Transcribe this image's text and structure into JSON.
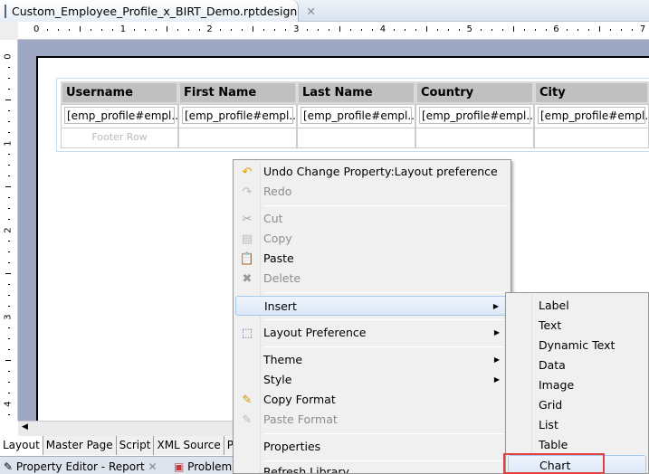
{
  "editor_tab": {
    "title": "Custom_Employee_Profile_x_BIRT_Demo.rptdesign",
    "icon": "report-design-icon"
  },
  "ruler": {
    "h_labels": [
      "0",
      "1",
      "2",
      "3",
      "4",
      "5",
      "6",
      "7"
    ],
    "v_labels": [
      "0",
      "1",
      "2",
      "3",
      "4"
    ]
  },
  "table": {
    "headers": [
      "Username",
      "First Name",
      "Last Name",
      "Country",
      "City"
    ],
    "row": [
      "[emp_profile#empl...]",
      "[emp_profile#empl...]",
      "[emp_profile#empl...]",
      "[emp_profile#empl...]",
      "[emp_profile#empl...]"
    ],
    "footer_label": "Footer Row"
  },
  "bottom_tabs": [
    "Layout",
    "Master Page",
    "Script",
    "XML Source",
    "Prev"
  ],
  "panel_tabs": [
    "Property Editor - Report",
    "Problem"
  ],
  "context_menu": {
    "items": [
      {
        "label": "Undo Change Property:Layout preference",
        "icon": "undo-icon",
        "disabled": false
      },
      {
        "label": "Redo",
        "icon": "redo-icon",
        "disabled": true
      },
      {
        "label": "Cut",
        "icon": "scissors-icon",
        "disabled": true
      },
      {
        "label": "Copy",
        "icon": "copy-icon",
        "disabled": true
      },
      {
        "label": "Paste",
        "icon": "paste-icon",
        "disabled": false
      },
      {
        "label": "Delete",
        "icon": "delete-icon",
        "disabled": true
      },
      {
        "label": "Insert",
        "submenu": true,
        "highlighted": true
      },
      {
        "label": "Layout Preference",
        "icon": "layout-icon",
        "submenu": true
      },
      {
        "label": "Theme",
        "submenu": true
      },
      {
        "label": "Style",
        "submenu": true
      },
      {
        "label": "Copy Format",
        "icon": "copy-format-icon",
        "disabled": false
      },
      {
        "label": "Paste Format",
        "icon": "paste-format-icon",
        "disabled": true
      },
      {
        "label": "Properties"
      },
      {
        "label": "Refresh Library"
      }
    ]
  },
  "insert_submenu": {
    "items": [
      "Label",
      "Text",
      "Dynamic Text",
      "Data",
      "Image",
      "Grid",
      "List",
      "Table",
      "Chart"
    ],
    "highlighted": "Chart",
    "highlight_color": "#e04040"
  }
}
